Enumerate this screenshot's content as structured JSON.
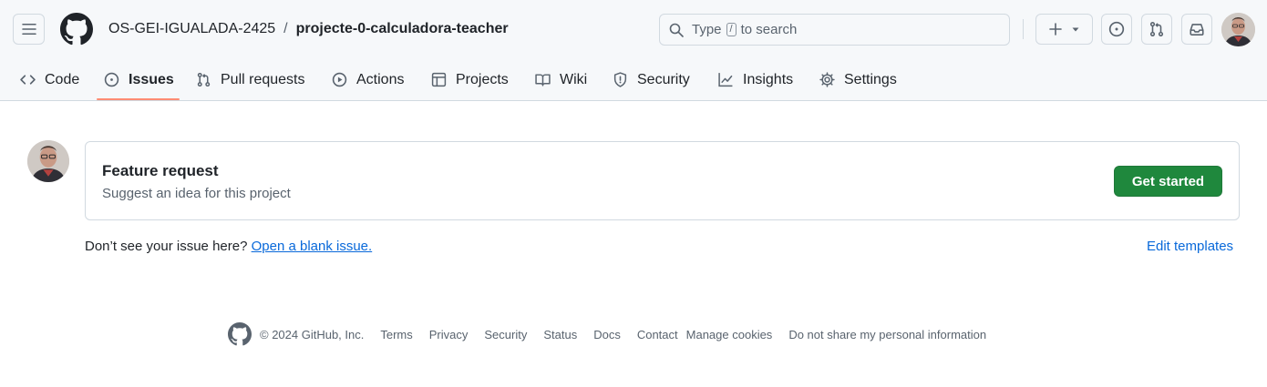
{
  "header": {
    "owner": "OS-GEI-IGUALADA-2425",
    "separator": "/",
    "repo": "projecte-0-calculadora-teacher",
    "search": {
      "before": "Type",
      "key": "/",
      "after": "to search"
    }
  },
  "tabs": [
    {
      "label": "Code",
      "icon": "code-icon"
    },
    {
      "label": "Issues",
      "icon": "issue-icon",
      "active": true
    },
    {
      "label": "Pull requests",
      "icon": "pull-request-icon"
    },
    {
      "label": "Actions",
      "icon": "play-icon"
    },
    {
      "label": "Projects",
      "icon": "table-icon"
    },
    {
      "label": "Wiki",
      "icon": "book-icon"
    },
    {
      "label": "Security",
      "icon": "shield-icon"
    },
    {
      "label": "Insights",
      "icon": "graph-icon"
    },
    {
      "label": "Settings",
      "icon": "gear-icon"
    }
  ],
  "template": {
    "title": "Feature request",
    "description": "Suggest an idea for this project",
    "button": "Get started"
  },
  "blank": {
    "prompt": "Don’t see your issue here? ",
    "link": "Open a blank issue.",
    "edit": "Edit templates"
  },
  "footer": {
    "copyright": "© 2024 GitHub, Inc.",
    "links": [
      "Terms",
      "Privacy",
      "Security",
      "Status",
      "Docs",
      "Contact",
      "Manage cookies",
      "Do not share my personal information"
    ]
  },
  "colors": {
    "accent_underline": "#fd8c73",
    "primary_button": "#1f883d",
    "link": "#0969da"
  }
}
